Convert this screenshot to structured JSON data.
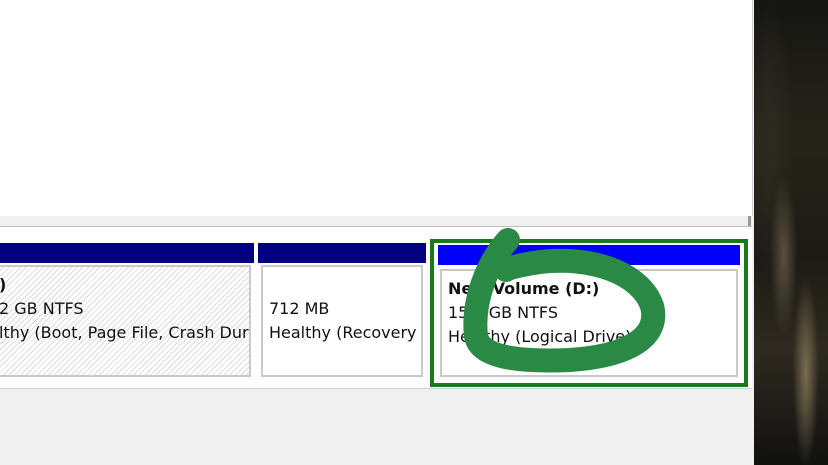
{
  "partitions": {
    "c_drive": {
      "name_fragment": ")",
      "size_fragment": "2 GB NTFS",
      "status_fragment": "lthy (Boot, Page File, Crash Dur"
    },
    "recovery": {
      "size": "712 MB",
      "status": "Healthy (Recovery"
    },
    "d_drive": {
      "name": "New Volume  (D:)",
      "size": "15  9 GB NTFS",
      "status": "Healthy (Logical Drive)"
    }
  },
  "colors": {
    "primary_bar": "#000080",
    "logical_bar": "#0000ff",
    "selection_border": "#1a7a1a",
    "annotation_stroke": "#2a8a45"
  },
  "icons": {
    "annotation": "hand-drawn-circle"
  }
}
